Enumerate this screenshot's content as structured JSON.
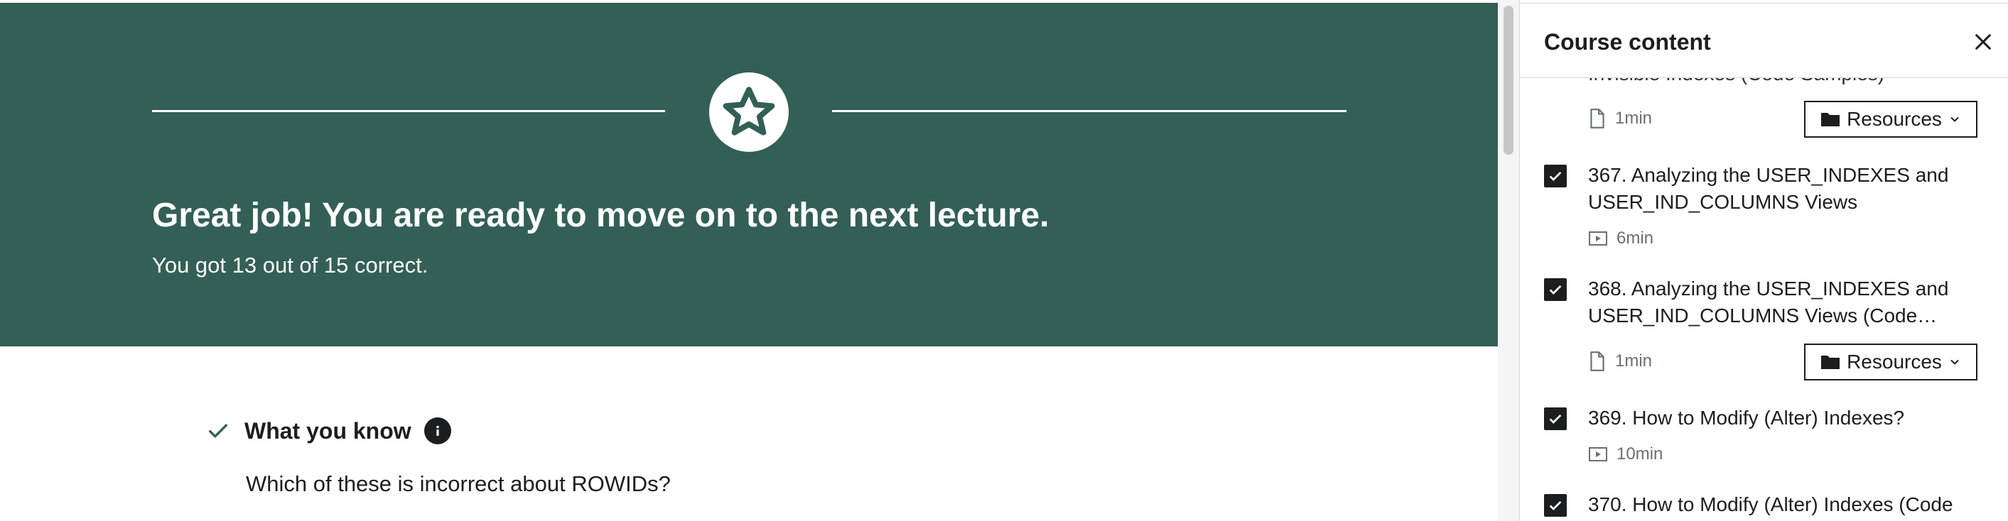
{
  "banner": {
    "title": "Great job! You are ready to move on to the next lecture.",
    "subtitle": "You got 13 out of 15 correct."
  },
  "review": {
    "section_label": "What you know",
    "question": "Which of these is incorrect about ROWIDs?"
  },
  "sidebar": {
    "title": "Course content",
    "partial_item_title": "Invisible Indexes (Code Samples)",
    "items": [
      {
        "partial": true,
        "duration": "1min",
        "icon": "file-icon",
        "resources": "Resources"
      },
      {
        "line1": "367. Analyzing the USER_INDEXES and",
        "line2": "USER_IND_COLUMNS Views",
        "duration": "6min",
        "icon": "video-icon",
        "completed": true
      },
      {
        "line1": "368. Analyzing the USER_INDEXES and",
        "line2": "USER_IND_COLUMNS Views (Code…",
        "duration": "1min",
        "icon": "file-icon",
        "resources": "Resources",
        "completed": true
      },
      {
        "line1": "369. How to Modify (Alter) Indexes?",
        "duration": "10min",
        "icon": "video-icon",
        "completed": true
      },
      {
        "line1": "370. How to Modify (Alter) Indexes (Code",
        "completed": true
      }
    ]
  },
  "colors": {
    "banner": "#335f56",
    "text": "#1c1d1f",
    "muted": "#6a6f73"
  }
}
